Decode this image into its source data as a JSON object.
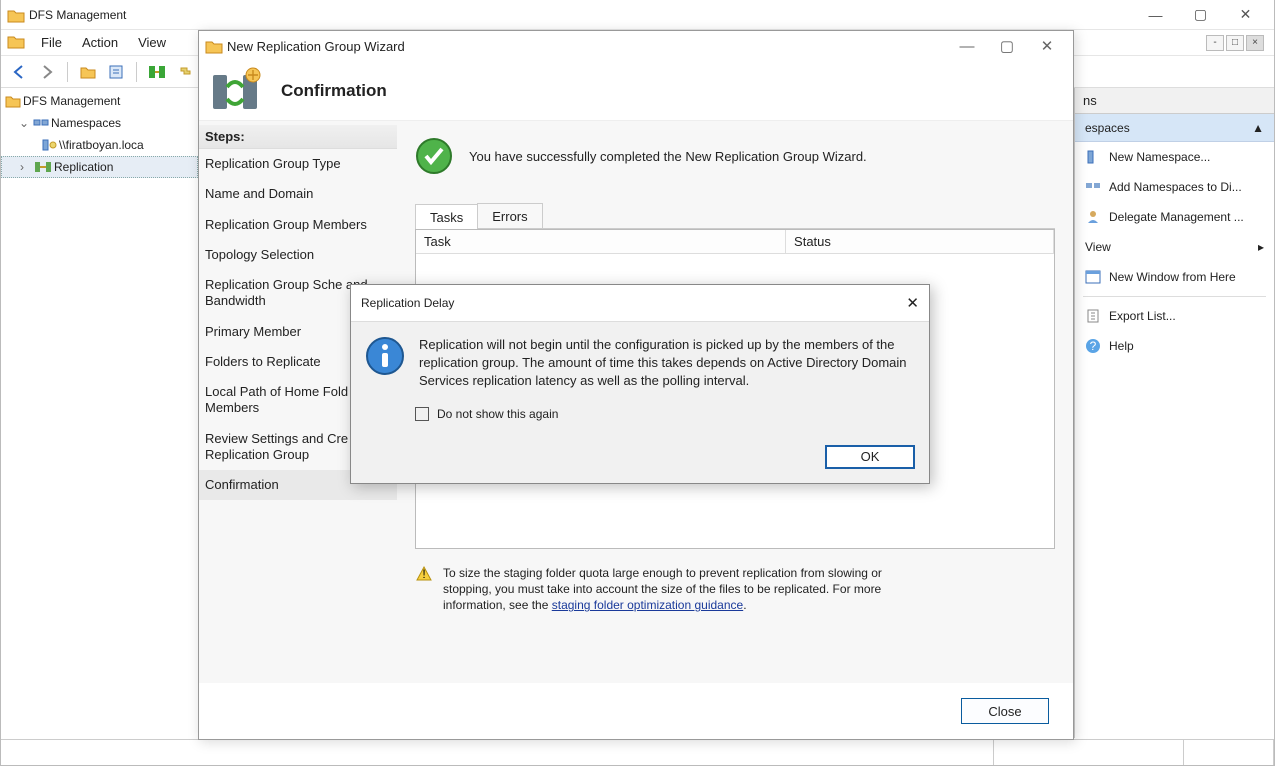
{
  "main": {
    "title": "DFS Management",
    "menu": {
      "file": "File",
      "action": "Action",
      "view": "View"
    },
    "tree": {
      "root": "DFS Management",
      "namespaces": "Namespaces",
      "namespace1": "\\\\firatboyan.loca",
      "replication": "Replication"
    }
  },
  "actions": {
    "header": "ns",
    "group": "espaces",
    "new_namespace": "New Namespace...",
    "add_ns": "Add Namespaces to Di...",
    "delegate": "Delegate Management ...",
    "view": "View",
    "new_window": "New Window from Here",
    "export": "Export List...",
    "help": "Help"
  },
  "wizard": {
    "title": "New Replication Group Wizard",
    "header": "Confirmation",
    "steps_label": "Steps:",
    "steps": [
      "Replication Group Type",
      "Name and Domain",
      "Replication Group Members",
      "Topology Selection",
      "Replication Group Schedule and Bandwidth",
      "Primary Member",
      "Folders to Replicate",
      "Local Path of Home Folder on Other Members",
      "Review Settings and Create Replication Group",
      "Confirmation"
    ],
    "steps_trunc": [
      "Replication Group Type",
      "Name and Domain",
      "Replication Group Members",
      "Topology Selection",
      "Replication Group Sche and Bandwidth",
      "Primary Member",
      "Folders to Replicate",
      "Local Path of Home Fold Other Members",
      "Review Settings and Cre Replication Group",
      "Confirmation"
    ],
    "success": "You have successfully completed the New Replication Group Wizard.",
    "tabs": {
      "tasks": "Tasks",
      "errors": "Errors"
    },
    "task_cols": {
      "task": "Task",
      "status": "Status"
    },
    "note_text": "To size the staging folder quota large enough to prevent replication from slowing or stopping, you must take into account the size of the files to be replicated. For more information, see the ",
    "note_link": "staging folder optimization guidance",
    "close": "Close"
  },
  "dialog": {
    "title": "Replication Delay",
    "msg": "Replication will not begin until the configuration is picked up by the members of the replication group. The amount of time this takes depends on Active Directory Domain Services replication latency as well as the polling interval.",
    "checkbox": "Do not show this again",
    "ok": "OK"
  }
}
